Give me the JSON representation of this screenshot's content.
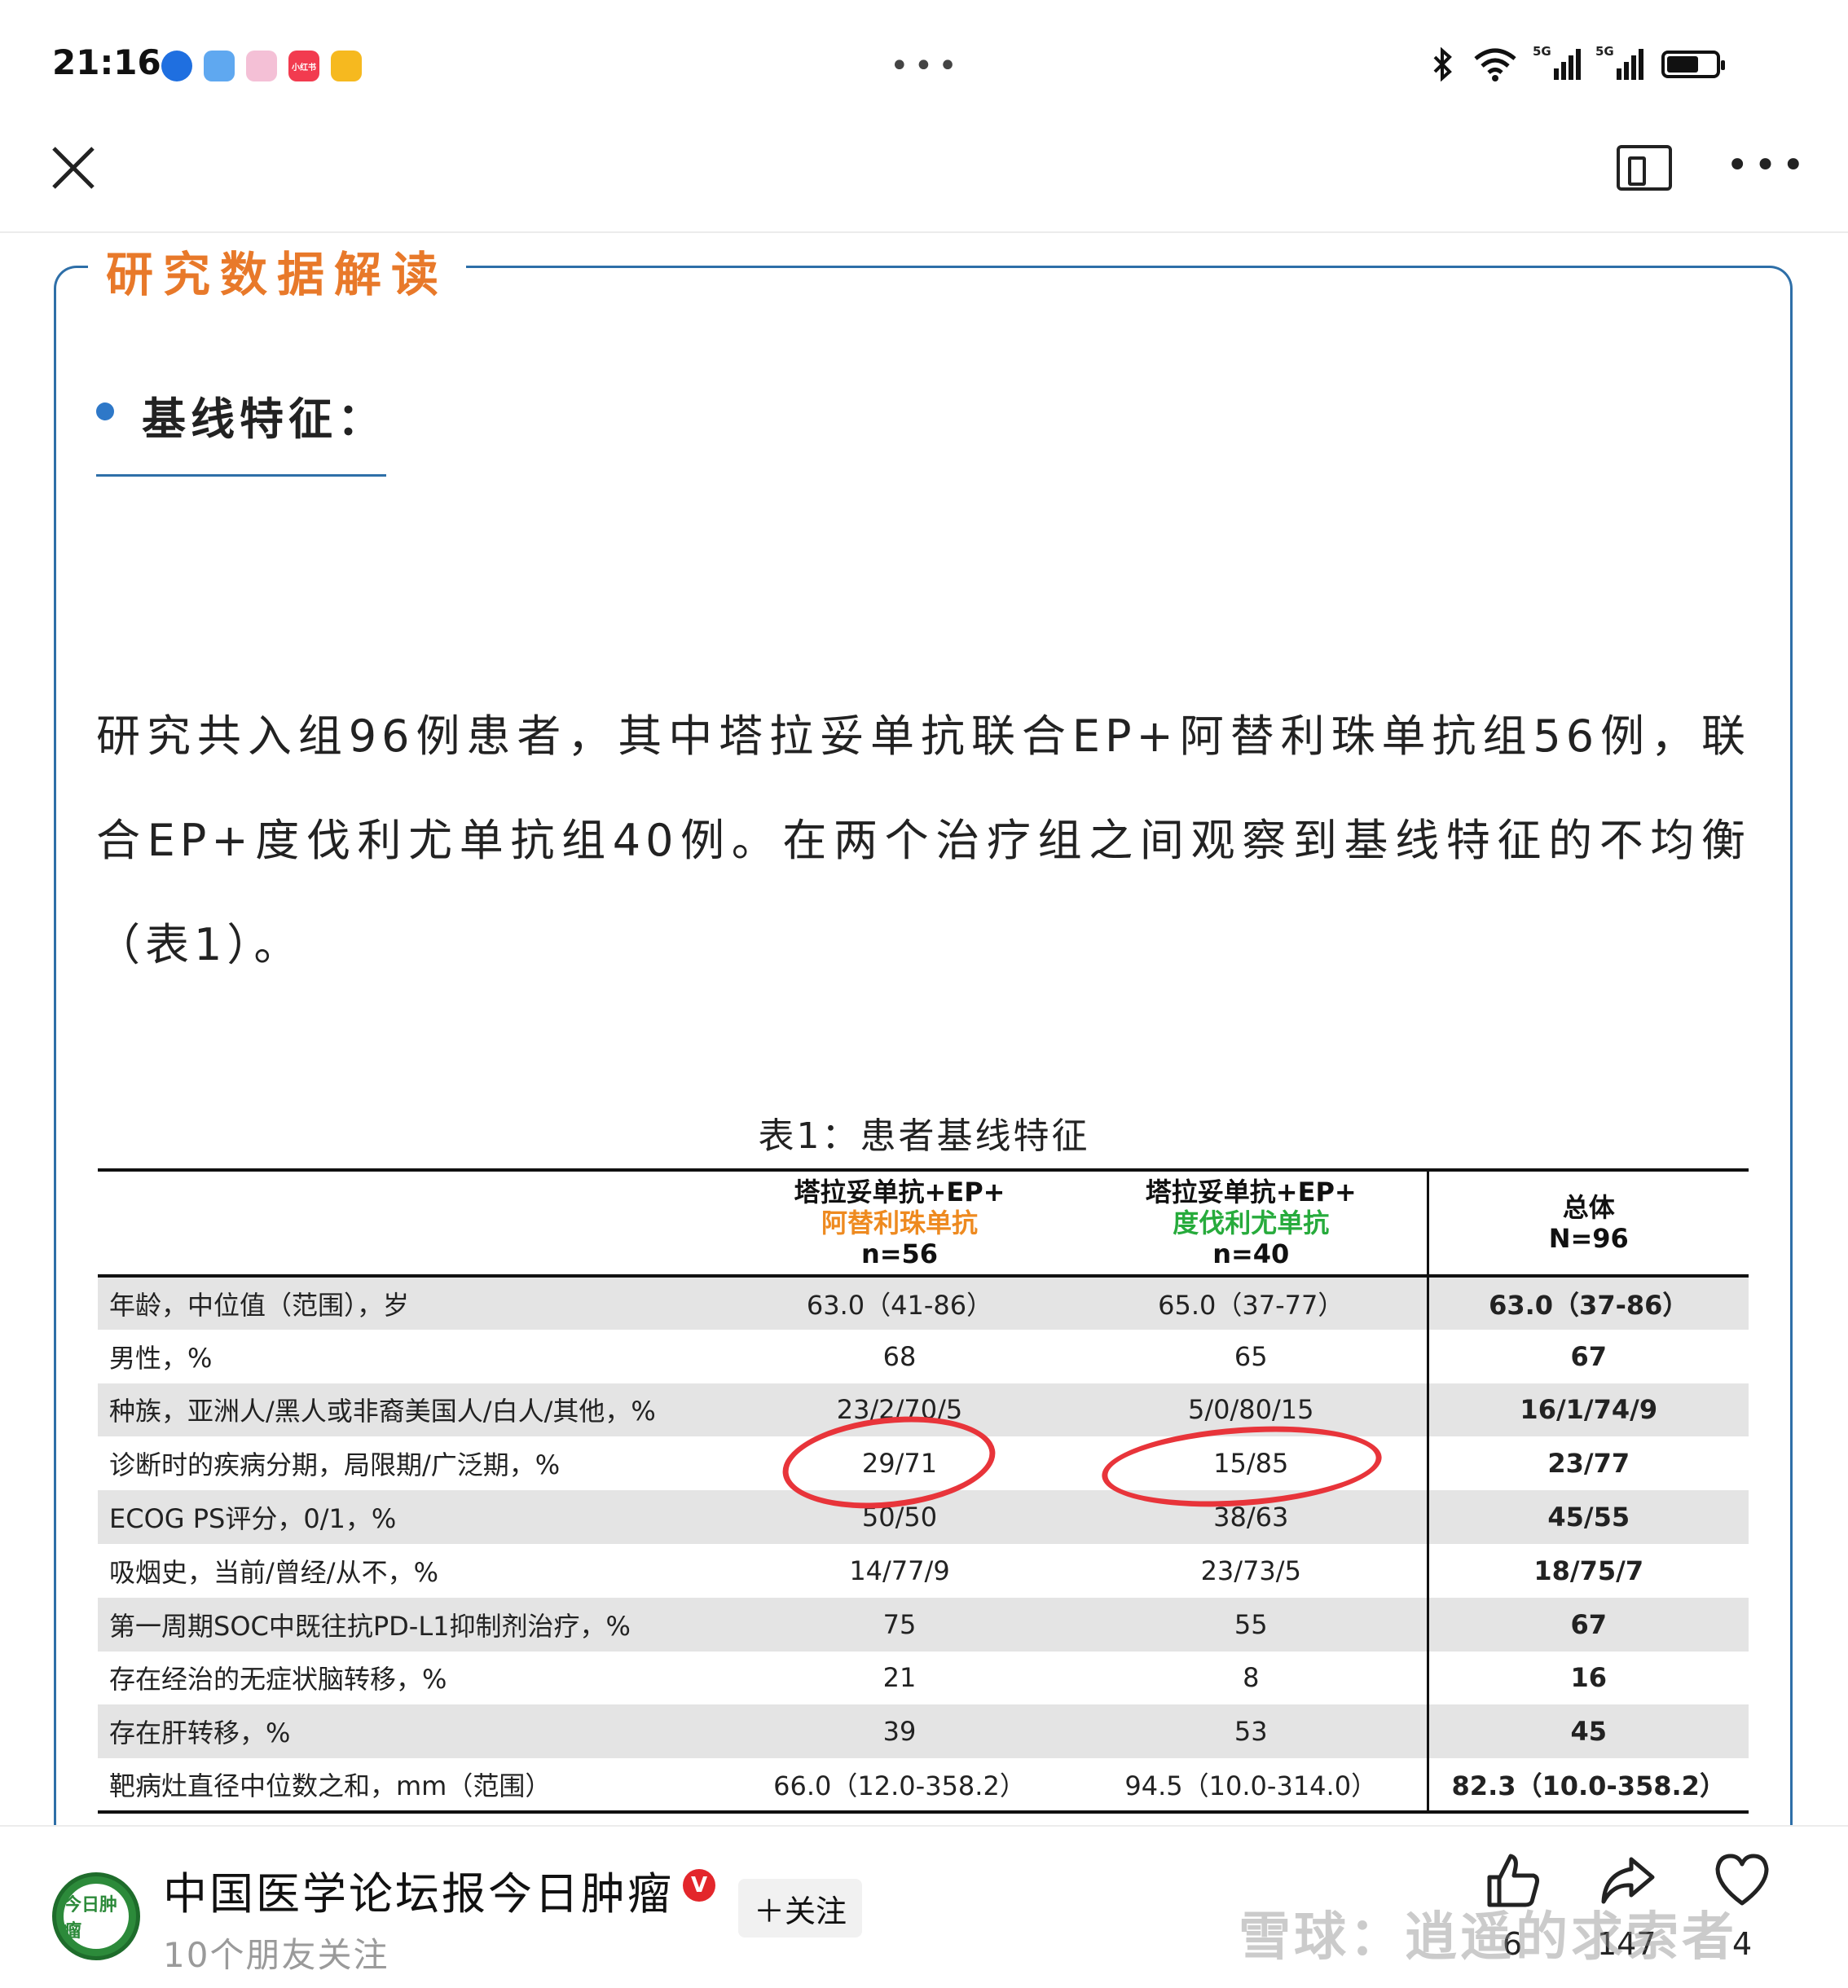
{
  "status_bar": {
    "time": "21:16",
    "network_1": "5G",
    "network_2": "5G",
    "app_badge": "小红书"
  },
  "colors": {
    "accent_orange": "#e8792a",
    "frame_blue": "#2e6fa8",
    "annotation_red": "#e8343a",
    "header_orange": "#ee8a20",
    "header_green": "#27ab3c"
  },
  "article": {
    "section_title": "研究数据解读",
    "sub_heading": "基线特征：",
    "paragraph": "研究共入组96例患者，其中塔拉妥单抗联合EP+阿替利珠单抗组56例，联合EP+度伐利尤单抗组40例。在两个治疗组之间观察到基线特征的不均衡（表1）。",
    "table_caption": "表1：患者基线特征"
  },
  "table": {
    "headers": {
      "g1_line1": "塔拉妥单抗+EP+",
      "g1_line2": "阿替利珠单抗",
      "g1_line3": "n=56",
      "g2_line1": "塔拉妥单抗+EP+",
      "g2_line2": "度伐利尤单抗",
      "g2_line3": "n=40",
      "total_line1": "总体",
      "total_line2": "N=96"
    },
    "rows": [
      {
        "label": "年龄，中位值（范围），岁",
        "g1": "63.0（41-86）",
        "g2": "65.0（37-77）",
        "total": "63.0（37-86）"
      },
      {
        "label": "男性，%",
        "g1": "68",
        "g2": "65",
        "total": "67"
      },
      {
        "label": "种族，亚洲人/黑人或非裔美国人/白人/其他，%",
        "g1": "23/2/70/5",
        "g2": "5/0/80/15",
        "total": "16/1/74/9"
      },
      {
        "label": "诊断时的疾病分期，局限期/广泛期，%",
        "g1": "29/71",
        "g2": "15/85",
        "total": "23/77"
      },
      {
        "label": "ECOG PS评分，0/1，%",
        "g1": "50/50",
        "g2": "38/63",
        "total": "45/55"
      },
      {
        "label": "吸烟史，当前/曾经/从不，%",
        "g1": "14/77/9",
        "g2": "23/73/5",
        "total": "18/75/7"
      },
      {
        "label": "第一周期SOC中既往抗PD-L1抑制剂治疗，%",
        "g1": "75",
        "g2": "55",
        "total": "67"
      },
      {
        "label": "存在经治的无症状脑转移，%",
        "g1": "21",
        "g2": "8",
        "total": "16"
      },
      {
        "label": "存在肝转移，%",
        "g1": "39",
        "g2": "53",
        "total": "45"
      },
      {
        "label": "靶病灶直径中位数之和，mm（范围）",
        "g1": "66.0（12.0-358.2）",
        "g2": "94.5（10.0-314.0）",
        "total": "82.3（10.0-358.2）"
      }
    ]
  },
  "bottom_bar": {
    "avatar_text": "今日肿瘤",
    "account_name": "中国医学论坛报今日肿瘤",
    "verified_mark": "V",
    "friends_text": "10个朋友关注",
    "follow_label": "＋关注",
    "like_count": "6",
    "share_count": "147",
    "favorite_count": "4",
    "watermark": "雪球：逍遥的求索者"
  }
}
